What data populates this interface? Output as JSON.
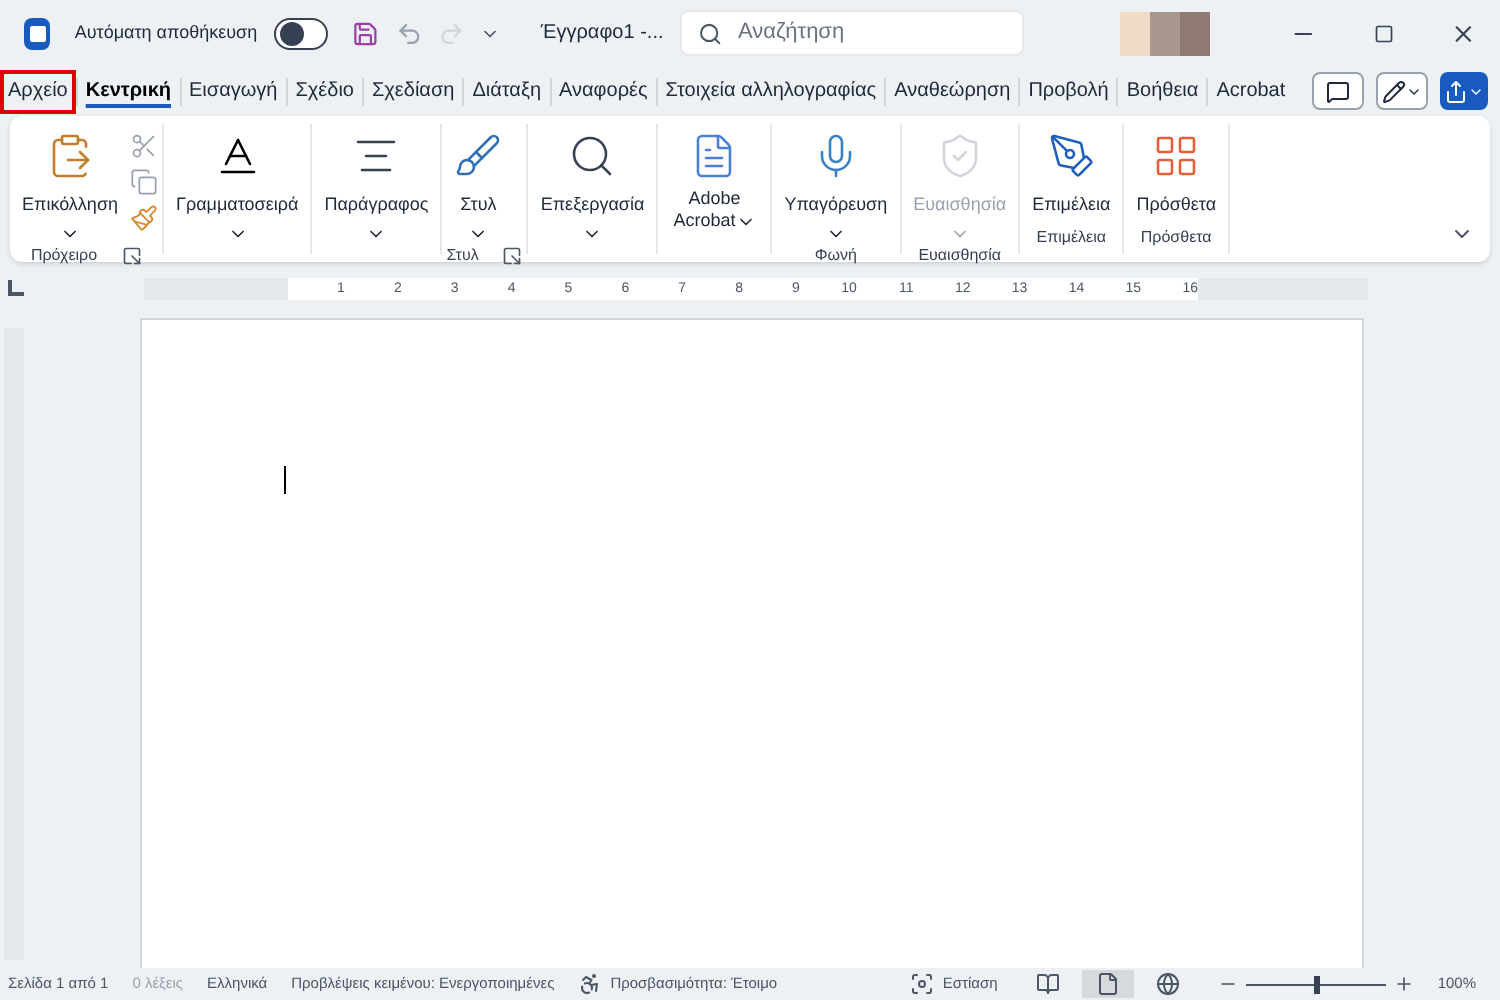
{
  "title_bar": {
    "autosave_label": "Αυτόματη αποθήκευση",
    "autosave_on": false,
    "doc_title": "Έγγραφο1 -...",
    "search": {
      "placeholder": "Αναζήτηση"
    }
  },
  "tabs": [
    {
      "label": "Αρχείο",
      "selected": false,
      "outlined": true
    },
    {
      "label": "Κεντρική",
      "selected": true,
      "outlined": false
    },
    {
      "label": "Εισαγωγή",
      "selected": false,
      "outlined": false
    },
    {
      "label": "Σχέδιο",
      "selected": false,
      "outlined": false
    },
    {
      "label": "Σχεδίαση",
      "selected": false,
      "outlined": false
    },
    {
      "label": "Διάταξη",
      "selected": false,
      "outlined": false
    },
    {
      "label": "Αναφορές",
      "selected": false,
      "outlined": false
    },
    {
      "label": "Στοιχεία αλληλογραφίας",
      "selected": false,
      "outlined": false
    },
    {
      "label": "Αναθεώρηση",
      "selected": false,
      "outlined": false
    },
    {
      "label": "Προβολή",
      "selected": false,
      "outlined": false
    },
    {
      "label": "Βοήθεια",
      "selected": false,
      "outlined": false
    },
    {
      "label": "Acrobat",
      "selected": false,
      "outlined": false
    }
  ],
  "ribbon": {
    "groups": [
      {
        "label": "Πρόχειρο",
        "launcher": true,
        "items": [
          {
            "kind": "paste",
            "label": "Επικόλληση",
            "dropdown": true,
            "disabled": false
          }
        ],
        "small": [
          {
            "kind": "cut",
            "disabled": true
          },
          {
            "kind": "copy",
            "disabled": true
          },
          {
            "kind": "painter",
            "disabled": false
          }
        ]
      },
      {
        "launcher": false,
        "items": [
          {
            "kind": "font",
            "label": "Γραμματοσειρά",
            "dropdown": true,
            "disabled": false
          }
        ]
      },
      {
        "launcher": false,
        "items": [
          {
            "kind": "paragraph",
            "label": "Παράγραφος",
            "dropdown": true,
            "disabled": false
          }
        ]
      },
      {
        "label": "Στυλ",
        "launcher": true,
        "items": [
          {
            "kind": "styles",
            "label": "Στυλ",
            "dropdown": true,
            "disabled": false
          }
        ]
      },
      {
        "launcher": false,
        "items": [
          {
            "kind": "search",
            "label": "Επεξεργασία",
            "dropdown": true,
            "disabled": false
          }
        ]
      },
      {
        "launcher": false,
        "items": [
          {
            "kind": "adobe",
            "label": "Adobe Acrobat",
            "dropdown": true,
            "disabled": false
          }
        ]
      },
      {
        "label": "Φωνή",
        "launcher": false,
        "items": [
          {
            "kind": "mic",
            "label": "Υπαγόρευση",
            "dropdown": true,
            "disabled": false
          }
        ]
      },
      {
        "label": "Ευαισθησία",
        "launcher": false,
        "items": [
          {
            "kind": "sensitivity",
            "label": "Ευαισθησία",
            "dropdown": true,
            "disabled": true
          }
        ]
      },
      {
        "label": "Επιμέλεια",
        "launcher": false,
        "items": [
          {
            "kind": "editor",
            "label": "Επιμέλεια",
            "dropdown": false,
            "disabled": false
          }
        ]
      },
      {
        "label": "Πρόσθετα",
        "launcher": false,
        "items": [
          {
            "kind": "addins",
            "label": "Πρόσθετα",
            "dropdown": false,
            "disabled": false
          }
        ]
      }
    ]
  },
  "ruler": {
    "numbers": [
      "1",
      "2",
      "3",
      "4",
      "5",
      "6",
      "7",
      "8",
      "9",
      "10",
      "11",
      "12",
      "13",
      "14",
      "15",
      "16"
    ]
  },
  "status_bar": {
    "page": "Σελίδα 1 από 1",
    "words": "0 λέξεις",
    "language": "Ελληνικά",
    "predictions": "Προβλέψεις κειμένου: Ενεργοποιημένες",
    "accessibility": "Προσβασιμότητα: Έτοιμο",
    "focus": "Εστίαση",
    "views": [
      {
        "kind": "read",
        "selected": false
      },
      {
        "kind": "print",
        "selected": true
      },
      {
        "kind": "web",
        "selected": false
      }
    ],
    "zoom": {
      "level": 0.5
    },
    "zoom_reading": "100%"
  }
}
